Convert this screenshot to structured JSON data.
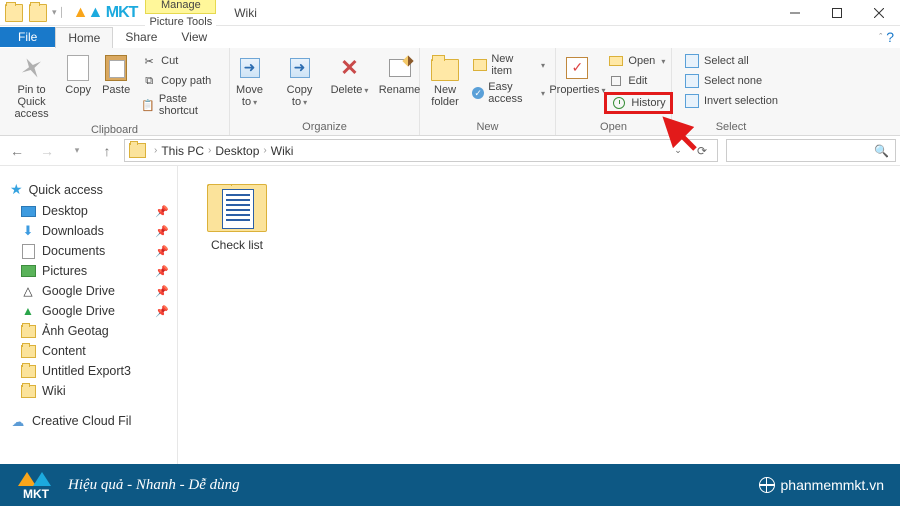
{
  "title": "Wiki",
  "contextTab": {
    "label": "Manage",
    "sub": "Picture Tools"
  },
  "tabs": {
    "file": "File",
    "home": "Home",
    "share": "Share",
    "view": "View"
  },
  "ribbon": {
    "pinQuick": "Pin to Quick access",
    "copy": "Copy",
    "paste": "Paste",
    "cut": "Cut",
    "copyPath": "Copy path",
    "pasteShortcut": "Paste shortcut",
    "moveTo": "Move to",
    "copyTo": "Copy to",
    "delete": "Delete",
    "rename": "Rename",
    "newFolder": "New folder",
    "newItem": "New item",
    "easyAccess": "Easy access",
    "properties": "Properties",
    "open": "Open",
    "edit": "Edit",
    "history": "History",
    "selectAll": "Select all",
    "selectNone": "Select none",
    "invertSel": "Invert selection",
    "groups": {
      "clipboard": "Clipboard",
      "organize": "Organize",
      "new": "New",
      "open": "Open",
      "select": "Select"
    }
  },
  "breadcrumb": {
    "thisPC": "This PC",
    "desktop": "Desktop",
    "wiki": "Wiki"
  },
  "sidebar": {
    "quickAccess": "Quick access",
    "items": [
      {
        "label": "Desktop"
      },
      {
        "label": "Downloads"
      },
      {
        "label": "Documents"
      },
      {
        "label": "Pictures"
      },
      {
        "label": "Google Drive"
      },
      {
        "label": "Google Drive"
      },
      {
        "label": "Ảnh Geotag"
      },
      {
        "label": "Content"
      },
      {
        "label": "Untitled Export3"
      },
      {
        "label": "Wiki"
      }
    ],
    "creativeCloud": "Creative Cloud Fil"
  },
  "content": {
    "item0": "Check list"
  },
  "brand": {
    "slogan": "Hiệu quả - Nhanh  - Dễ dùng",
    "url": "phanmemmkt.vn",
    "logoText": "MKT"
  }
}
